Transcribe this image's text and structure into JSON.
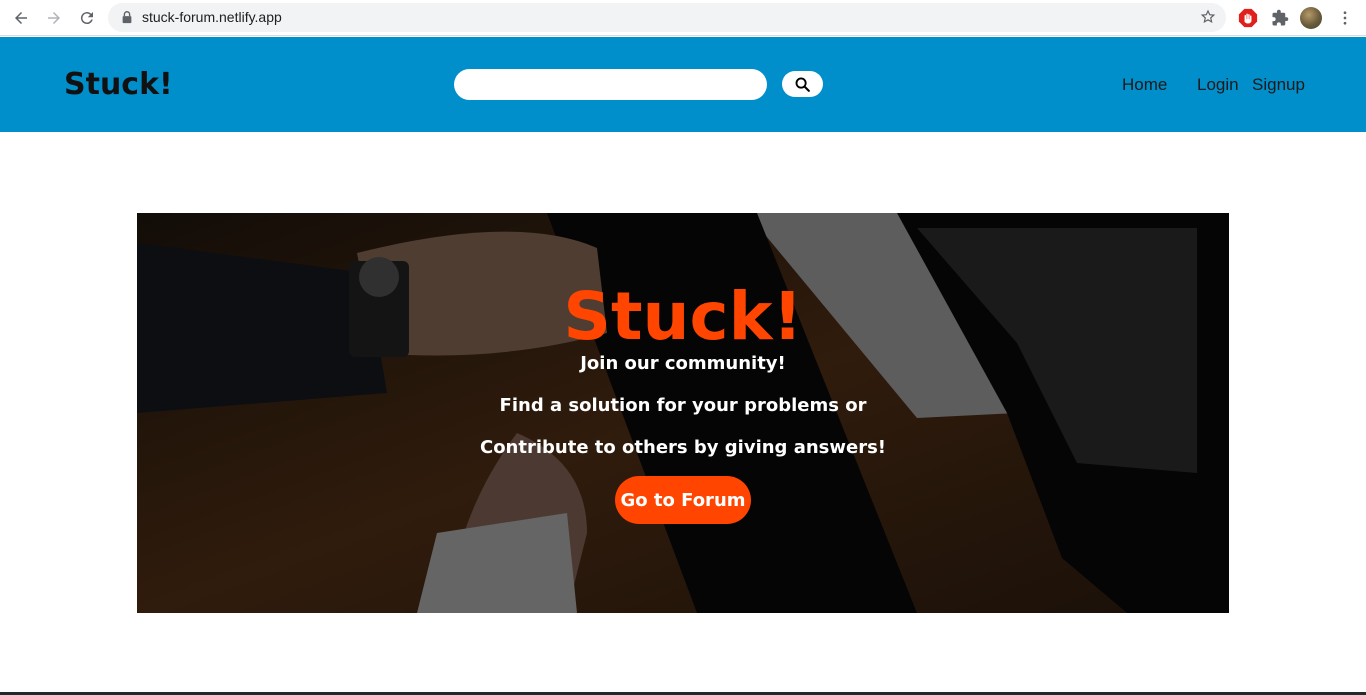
{
  "browser": {
    "url": "stuck-forum.netlify.app"
  },
  "header": {
    "brand": "Stuck!",
    "search": {
      "value": "",
      "placeholder": ""
    },
    "nav": {
      "home": "Home",
      "login": "Login",
      "signup": "Signup"
    },
    "background_color": "#008fca"
  },
  "hero": {
    "title": "Stuck!",
    "line1": "Join our community!",
    "line2": "Find a solution for your problems or",
    "line3": "Contribute to others by giving answers!",
    "cta_label": "Go to Forum",
    "accent_color": "#ff4500"
  },
  "icons": {
    "back": "back-arrow-icon",
    "forward": "forward-arrow-icon",
    "reload": "reload-icon",
    "lock": "lock-icon",
    "bookmark": "star-icon",
    "extension_adblock": "stop-hand-icon",
    "extensions": "puzzle-icon",
    "profile": "avatar",
    "menu": "kebab-menu-icon",
    "search": "search-icon"
  }
}
